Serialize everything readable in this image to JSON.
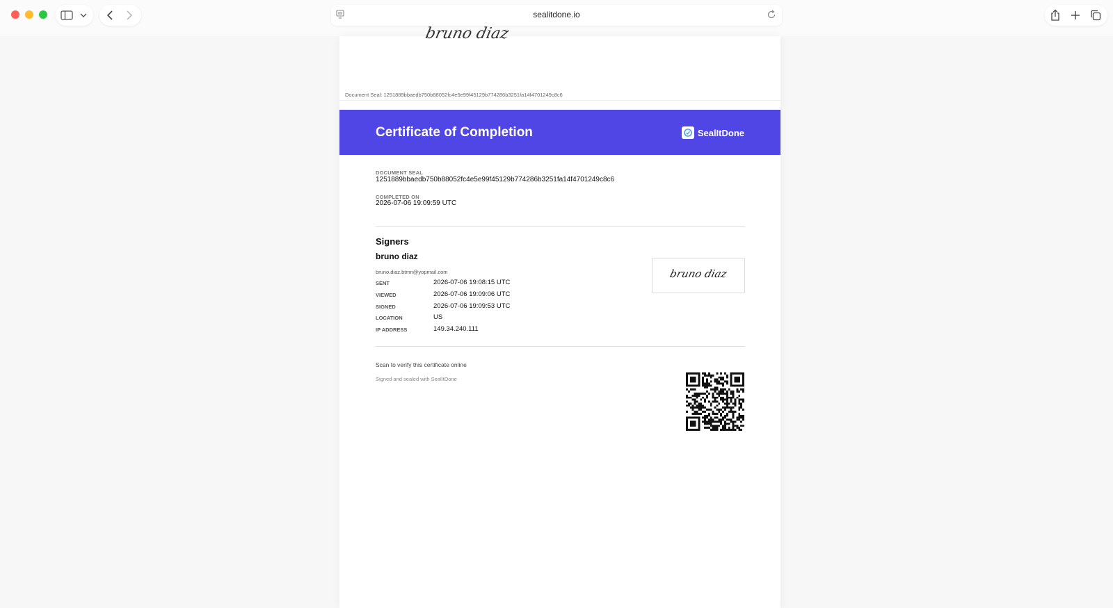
{
  "browser": {
    "url": "sealitdone.io"
  },
  "previous_page": {
    "signature_text": "bruno diaz",
    "seal_line": "Document Seal: 1251889bbaedb750b88052fc4e5e99f45129b774286b3251fa14f4701249c8c6"
  },
  "certificate": {
    "title": "Certificate of Completion",
    "brand_name": "SealItDone",
    "header_color": "#5046e5",
    "document_seal_label": "DOCUMENT SEAL",
    "document_seal_value": "1251889bbaedb750b88052fc4e5e99f45129b774286b3251fa14f4701249c8c6",
    "completed_on_label": "COMPLETED ON",
    "completed_on_value": "2026-07-06 19:09:59 UTC",
    "signers_heading": "Signers",
    "signer": {
      "name": "bruno diaz",
      "email": "bruno.diaz.btmn@yopmail.com",
      "signature_text": "bruno diaz",
      "details": [
        {
          "key": "SENT",
          "value": "2026-07-06 19:08:15 UTC"
        },
        {
          "key": "VIEWED",
          "value": "2026-07-06 19:09:06 UTC"
        },
        {
          "key": "SIGNED",
          "value": "2026-07-06 19:09:53 UTC"
        },
        {
          "key": "LOCATION",
          "value": "US"
        },
        {
          "key": "IP ADDRESS",
          "value": "149.34.240.111"
        }
      ]
    },
    "scan_text": "Scan to verify this certificate online",
    "sealed_text": "Signed and sealed with SealItDone"
  }
}
